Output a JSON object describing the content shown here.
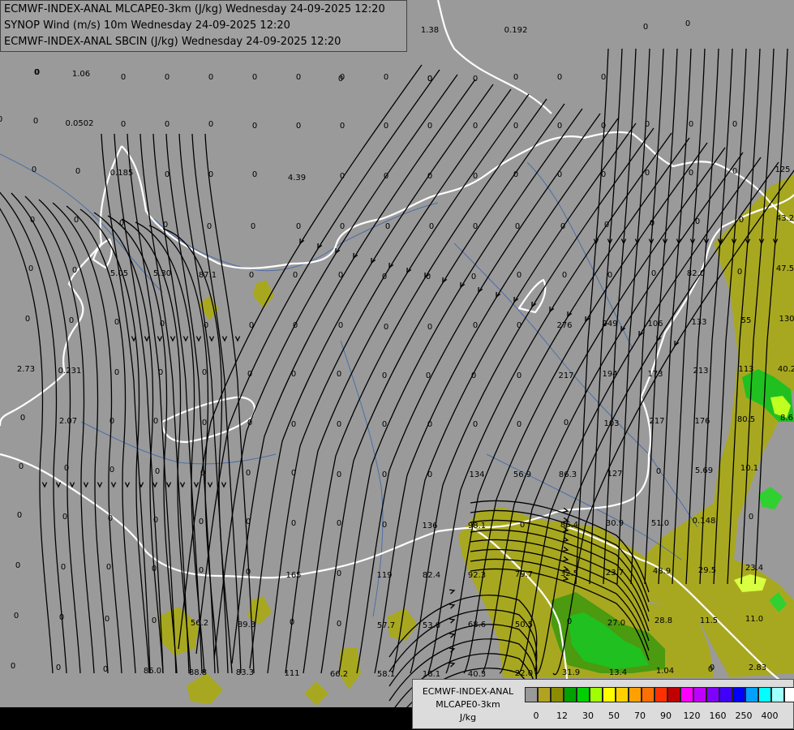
{
  "header": {
    "line1": "ECMWF-INDEX-ANAL MLCAPE0-3km (J/kg) Wednesday 24-09-2025 12:20",
    "line2": "SYNOP Wind (m/s) 10m Wednesday 24-09-2025 12:20",
    "line3": "ECMWF-INDEX-ANAL SBCIN (J/kg) Wednesday 24-09-2025 12:20"
  },
  "legend": {
    "title1": "ECMWF-INDEX-ANAL",
    "title2": "MLCAPE0-3km",
    "unit": "J/kg",
    "ticks": [
      "0",
      "12",
      "30",
      "50",
      "70",
      "90",
      "120",
      "160",
      "250",
      "400"
    ],
    "colors": [
      "#999999",
      "#b1a31f",
      "#8c8c00",
      "#00a000",
      "#00d000",
      "#a0ff00",
      "#ffff00",
      "#ffd000",
      "#ffa000",
      "#ff7000",
      "#ff3000",
      "#c00000",
      "#ff00ff",
      "#c000ff",
      "#8000ff",
      "#4000ff",
      "#0000ff",
      "#00a0ff",
      "#00ffff",
      "#a0ffff",
      "#ffffff"
    ]
  },
  "colors": {
    "background": "#9a9a9a",
    "cape_low": "#a8a820",
    "cape_mid": "#5a8a00",
    "cape_green": "#20c020",
    "cape_yellow": "#ffff40",
    "border": "#ffffff",
    "streamline": "#000000",
    "river": "#4d6ea8"
  },
  "values": [
    {
      "t": "1.38",
      "x": 1.38,
      "y": 0
    },
    {
      "t": "0.192",
      "x": 0,
      "y": 0
    },
    {
      "t": "0",
      "x": 0,
      "y": 0
    },
    {
      "t": "0",
      "x": 0,
      "y": 0
    },
    {
      "t": "1.06",
      "x": 0,
      "y": 0
    },
    {
      "t": "0",
      "x": 0,
      "y": 0
    },
    {
      "t": "0",
      "x": 0,
      "y": 0
    },
    {
      "t": "0",
      "x": 0,
      "y": 0
    },
    {
      "t": "0.0502",
      "x": 0,
      "y": 0
    },
    {
      "t": "4.39",
      "x": 0,
      "y": 0
    },
    {
      "t": "0.185",
      "x": 0,
      "y": 0
    },
    {
      "t": "125",
      "x": 0,
      "y": 0
    },
    {
      "t": "43.2",
      "x": 0,
      "y": 0
    },
    {
      "t": "47.5",
      "x": 0,
      "y": 0
    },
    {
      "t": "82.0",
      "x": 0,
      "y": 0
    },
    {
      "t": "87.1",
      "x": 0,
      "y": 0
    },
    {
      "t": "5.05",
      "x": 0,
      "y": 0
    },
    {
      "t": "5.30",
      "x": 0,
      "y": 0
    },
    {
      "t": "276",
      "x": 0,
      "y": 0
    },
    {
      "t": "249",
      "x": 0,
      "y": 0
    },
    {
      "t": "106",
      "x": 0,
      "y": 0
    },
    {
      "t": "133",
      "x": 0,
      "y": 0
    },
    {
      "t": "55",
      "x": 0,
      "y": 0
    },
    {
      "t": "130",
      "x": 0,
      "y": 0
    },
    {
      "t": "2.73",
      "x": 0,
      "y": 0
    },
    {
      "t": "0.231",
      "x": 0,
      "y": 0
    },
    {
      "t": "217",
      "x": 0,
      "y": 0
    },
    {
      "t": "194",
      "x": 0,
      "y": 0
    },
    {
      "t": "173",
      "x": 0,
      "y": 0
    },
    {
      "t": "213",
      "x": 0,
      "y": 0
    },
    {
      "t": "113",
      "x": 0,
      "y": 0
    },
    {
      "t": "40.2",
      "x": 0,
      "y": 0
    },
    {
      "t": "2.07",
      "x": 0,
      "y": 0
    },
    {
      "t": "103",
      "x": 0,
      "y": 0
    },
    {
      "t": "217",
      "x": 0,
      "y": 0
    },
    {
      "t": "176",
      "x": 0,
      "y": 0
    },
    {
      "t": "80.5",
      "x": 0,
      "y": 0
    },
    {
      "t": "8.6",
      "x": 0,
      "y": 0
    },
    {
      "t": "134",
      "x": 0,
      "y": 0
    },
    {
      "t": "56.9",
      "x": 0,
      "y": 0
    },
    {
      "t": "86.3",
      "x": 0,
      "y": 0
    },
    {
      "t": "127",
      "x": 0,
      "y": 0
    },
    {
      "t": "5.69",
      "x": 0,
      "y": 0
    },
    {
      "t": "10.1",
      "x": 0,
      "y": 0
    },
    {
      "t": "136",
      "x": 0,
      "y": 0
    },
    {
      "t": "98.1",
      "x": 0,
      "y": 0
    },
    {
      "t": "86.4",
      "x": 0,
      "y": 0
    },
    {
      "t": "30.9",
      "x": 0,
      "y": 0
    },
    {
      "t": "51.0",
      "x": 0,
      "y": 0
    },
    {
      "t": "0.148",
      "x": 0,
      "y": 0
    },
    {
      "t": "165",
      "x": 0,
      "y": 0
    },
    {
      "t": "119",
      "x": 0,
      "y": 0
    },
    {
      "t": "82.4",
      "x": 0,
      "y": 0
    },
    {
      "t": "92.3",
      "x": 0,
      "y": 0
    },
    {
      "t": "79.7",
      "x": 0,
      "y": 0
    },
    {
      "t": "32.5",
      "x": 0,
      "y": 0
    },
    {
      "t": "23.7",
      "x": 0,
      "y": 0
    },
    {
      "t": "48.9",
      "x": 0,
      "y": 0
    },
    {
      "t": "29.5",
      "x": 0,
      "y": 0
    },
    {
      "t": "23.4",
      "x": 0,
      "y": 0
    },
    {
      "t": "56.2",
      "x": 0,
      "y": 0
    },
    {
      "t": "89.3",
      "x": 0,
      "y": 0
    },
    {
      "t": "57.7",
      "x": 0,
      "y": 0
    },
    {
      "t": "53.0",
      "x": 0,
      "y": 0
    },
    {
      "t": "68.6",
      "x": 0,
      "y": 0
    },
    {
      "t": "50.5",
      "x": 0,
      "y": 0
    },
    {
      "t": "27.0",
      "x": 0,
      "y": 0
    },
    {
      "t": "28.8",
      "x": 0,
      "y": 0
    },
    {
      "t": "11.5",
      "x": 0,
      "y": 0
    },
    {
      "t": "11.0",
      "x": 0,
      "y": 0
    },
    {
      "t": "86.0",
      "x": 0,
      "y": 0
    },
    {
      "t": "88.8",
      "x": 0,
      "y": 0
    },
    {
      "t": "83.3",
      "x": 0,
      "y": 0
    },
    {
      "t": "111",
      "x": 0,
      "y": 0
    },
    {
      "t": "66.2",
      "x": 0,
      "y": 0
    },
    {
      "t": "58.1",
      "x": 0,
      "y": 0
    },
    {
      "t": "16.1",
      "x": 0,
      "y": 0
    },
    {
      "t": "40.3",
      "x": 0,
      "y": 0
    },
    {
      "t": "22.0",
      "x": 0,
      "y": 0
    },
    {
      "t": "31.9",
      "x": 0,
      "y": 0
    },
    {
      "t": "13.4",
      "x": 0,
      "y": 0
    },
    {
      "t": "1.04",
      "x": 0,
      "y": 0
    },
    {
      "t": "0",
      "x": 0,
      "y": 0
    },
    {
      "t": "2.83",
      "x": 0,
      "y": 0
    }
  ]
}
